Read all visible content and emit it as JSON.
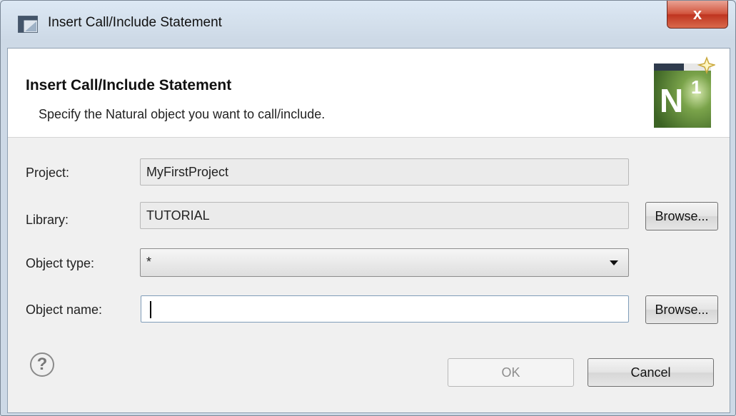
{
  "window": {
    "title": "Insert Call/Include Statement",
    "close_label": "x"
  },
  "banner": {
    "title": "Insert Call/Include Statement",
    "description": "Specify the Natural object you want to call/include.",
    "logo_text": "N",
    "logo_superscript": "1"
  },
  "form": {
    "project": {
      "label": "Project:",
      "value": "MyFirstProject"
    },
    "library": {
      "label": "Library:",
      "value": "TUTORIAL",
      "browse_label": "Browse..."
    },
    "object_type": {
      "label": "Object type:",
      "value": "*"
    },
    "object_name": {
      "label": "Object name:",
      "value": "",
      "browse_label": "Browse..."
    }
  },
  "footer": {
    "help_symbol": "?",
    "ok_label": "OK",
    "cancel_label": "Cancel"
  },
  "colors": {
    "close_button": "#c9432b",
    "titlebar": "#d6e2ee",
    "dialog_background": "#f0f0f0",
    "logo_green": "#4f7a2e"
  }
}
